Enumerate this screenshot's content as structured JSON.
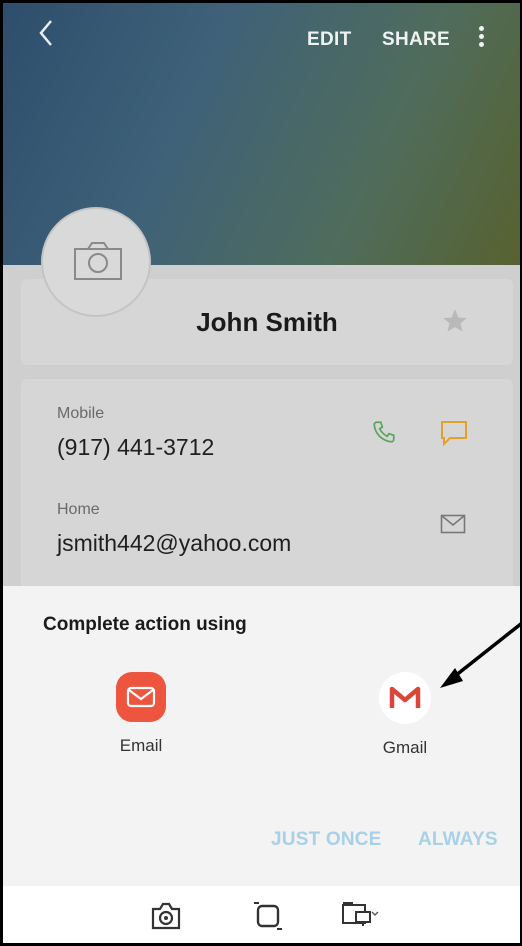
{
  "header": {
    "edit_label": "EDIT",
    "share_label": "SHARE",
    "back_icon": "back-chevron-icon",
    "more_icon": "more-vertical-icon",
    "gradient_colors": [
      "#2d4e6c",
      "#57622f"
    ]
  },
  "contact": {
    "name": "John Smith",
    "fields": [
      {
        "label": "Mobile",
        "value": "(917) 441-3712"
      },
      {
        "label": "Home",
        "value": "jsmith442@yahoo.com"
      }
    ]
  },
  "chooser": {
    "title": "Complete action using",
    "apps": [
      {
        "label": "Email",
        "icon": "email-app-icon",
        "color": "#ee553f"
      },
      {
        "label": "Gmail",
        "icon": "gmail-app-icon",
        "color": "#d9463a"
      }
    ],
    "just_once_label": "JUST ONCE",
    "always_label": "ALWAYS",
    "button_color": "#a9d0e6"
  },
  "navbar": {
    "icons": [
      "camera-capture-icon",
      "recents-square-icon",
      "device-switch-icon"
    ]
  }
}
